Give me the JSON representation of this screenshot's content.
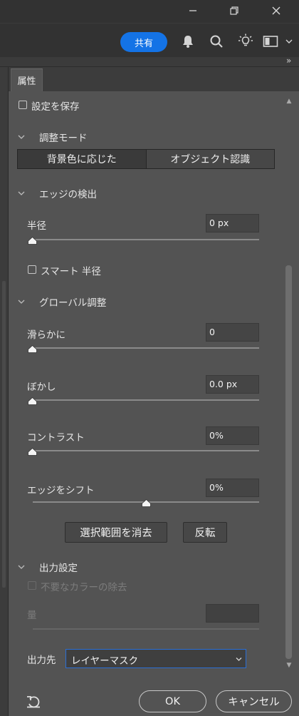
{
  "window": {
    "minimize_glyph": "—",
    "restore_glyph": "❐",
    "close_glyph": "✕"
  },
  "appbar": {
    "share_label": "共有",
    "share_color": "#1473e6",
    "icons": [
      "bell-icon",
      "search-icon",
      "lightbulb-icon",
      "workspace-icon",
      "chevron-down-icon"
    ]
  },
  "dock": {
    "collapse_glyph": "»"
  },
  "panel": {
    "tab_label": "属性",
    "save_settings_label": "設定を保存",
    "adjust_mode": {
      "header": "調整モード",
      "options": [
        "背景色に応じた",
        "オブジェクト認識"
      ],
      "selected": "背景色に応じた"
    },
    "edge_detection": {
      "header": "エッジの検出",
      "radius_label": "半径",
      "radius_value": "0 px",
      "radius_level": 0,
      "smart_radius_label": "スマート 半径"
    },
    "global": {
      "header": "グローバル調整",
      "smooth_label": "滑らかに",
      "smooth_value": "0",
      "smooth_level": 0,
      "feather_label": "ぼかし",
      "feather_value": "0.0 px",
      "feather_level": 0,
      "contrast_label": "コントラスト",
      "contrast_value": "0%",
      "contrast_level": 0,
      "shift_label": "エッジをシフト",
      "shift_value": "0%",
      "shift_level": 0.5,
      "clear_selection_label": "選択範囲を消去",
      "invert_label": "反転"
    },
    "output": {
      "header": "出力設定",
      "decontaminate_label": "不要なカラーの除去",
      "amount_label": "量",
      "amount_value": "",
      "output_to_label": "出力先",
      "output_to_value": "レイヤーマスク"
    },
    "footer": {
      "ok_label": "OK",
      "cancel_label": "キャンセル",
      "reset_icon": "reset-icon"
    }
  }
}
